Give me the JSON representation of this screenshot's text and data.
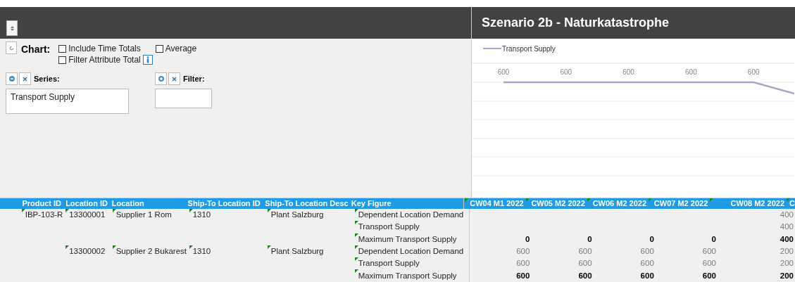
{
  "panel": {
    "chart_label": "Chart:",
    "options": [
      {
        "label": "Include Time Totals",
        "checked": false
      },
      {
        "label": "Average",
        "checked": false
      },
      {
        "label": "Filter Attribute Total",
        "checked": false
      }
    ],
    "series_label": "Series:",
    "series_items": [
      "Transport Supply"
    ],
    "filter_label": "Filter:"
  },
  "chart_panel": {
    "title": "Szenario 2b - Naturkatastrophe",
    "legend": "Transport Supply",
    "point_labels": [
      "600",
      "600",
      "600",
      "600",
      "600"
    ]
  },
  "table": {
    "columns": [
      "Product ID",
      "Location ID",
      "Location",
      "Ship-To Location ID",
      "Ship-To Location Desc",
      "Key Figure",
      "CW04 M1 2022",
      "CW05 M2 2022",
      "CW06 M2 2022",
      "CW07 M2 2022",
      "CW08 M2 2022",
      "C"
    ],
    "rows": [
      {
        "cells": [
          "IBP-103-R",
          "13300001",
          "Supplier 1 Rom",
          "1310",
          "Plant Salzburg",
          "Dependent Location Demand",
          "",
          "",
          "",
          "",
          "400"
        ],
        "bold": false
      },
      {
        "cells": [
          "",
          "",
          "",
          "",
          "",
          "Transport Supply",
          "",
          "",
          "",
          "",
          "400"
        ],
        "bold": false
      },
      {
        "cells": [
          "",
          "",
          "",
          "",
          "",
          "Maximum Transport Supply",
          "0",
          "0",
          "0",
          "0",
          "400"
        ],
        "bold": true
      },
      {
        "cells": [
          "",
          "13300002",
          "Supplier 2 Bukarest",
          "1310",
          "Plant Salzburg",
          "Dependent Location Demand",
          "600",
          "600",
          "600",
          "600",
          "200"
        ],
        "bold": false
      },
      {
        "cells": [
          "",
          "",
          "",
          "",
          "",
          "Transport Supply",
          "600",
          "600",
          "600",
          "600",
          "200"
        ],
        "bold": false
      },
      {
        "cells": [
          "",
          "",
          "",
          "",
          "",
          "Maximum Transport Supply",
          "600",
          "600",
          "600",
          "600",
          "200"
        ],
        "bold": true
      }
    ]
  }
}
